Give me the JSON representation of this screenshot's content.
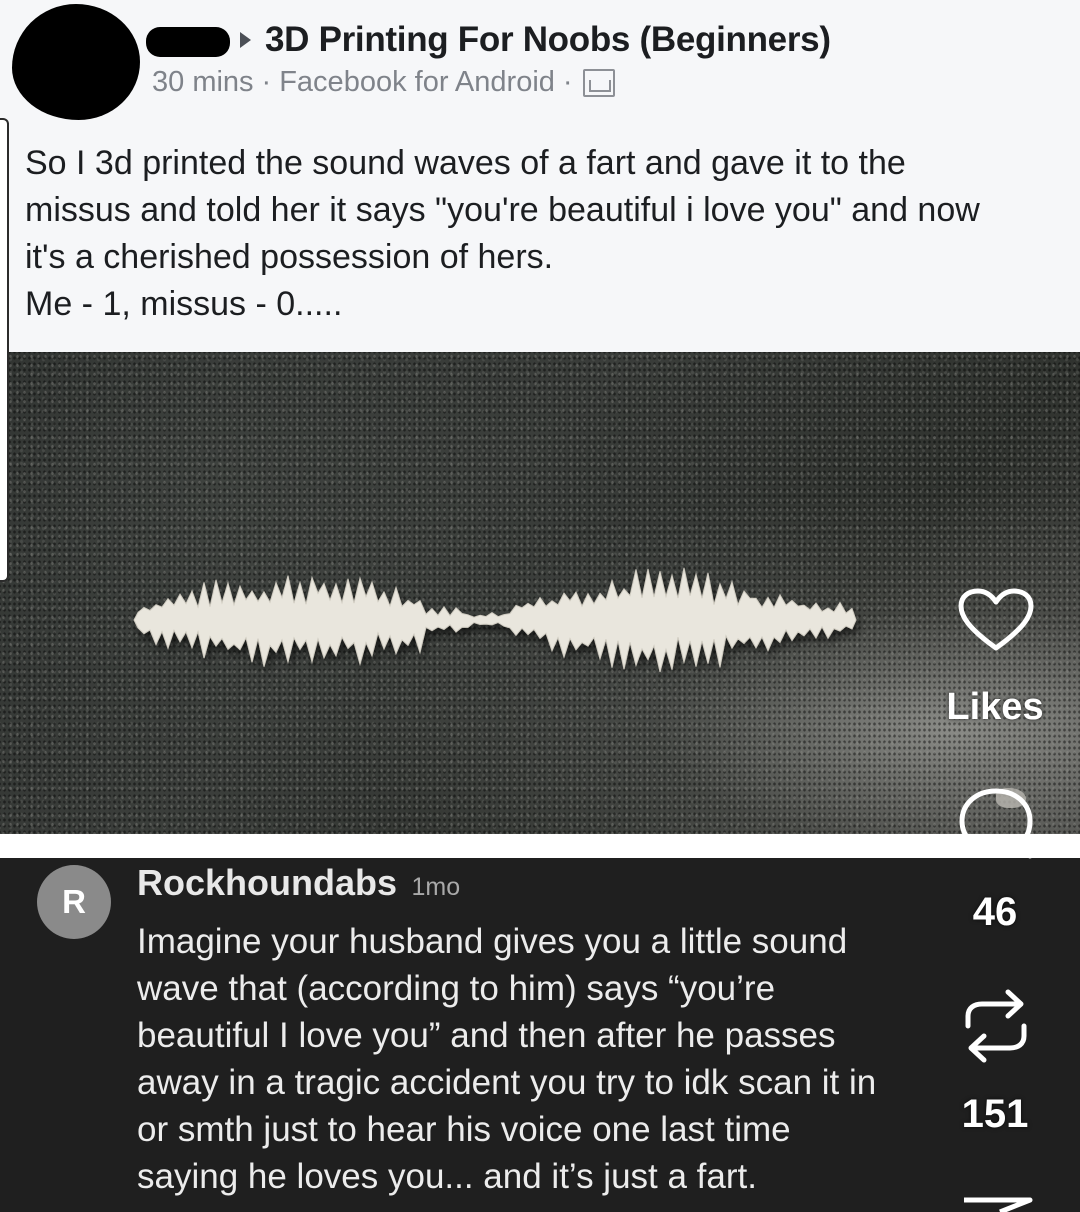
{
  "post": {
    "group_name": "3D Printing For Noobs (Beginners)",
    "time": "30 mins",
    "source": "Facebook for Android",
    "separator": "·",
    "text": "So I 3d printed the sound waves of a fart and gave it to the\nmissus and told her it says \"you're beautiful i love you\" and now\nit's a cherished possession of hers.\nMe - 1, missus - 0....."
  },
  "comment": {
    "avatar_letter": "R",
    "username": "Rockhoundabs",
    "time": "1mo",
    "text": "Imagine your husband gives you a little sound\nwave that (according to him) says “you’re\nbeautiful I love you” and then after he passes\naway in a tragic accident you try to idk scan it in\nor smth just to hear his voice one last time\nsaying he loves you... and it’s just a fart."
  },
  "overlay": {
    "likes_label": "Likes",
    "comments_count": "46",
    "reposts_count": "151",
    "icons": [
      "heart-icon",
      "comment-icon",
      "repost-icon",
      "share-icon"
    ]
  },
  "colors": {
    "post_background": "#f6f7f9",
    "comment_background": "#1f1f1f",
    "overlay_text": "#ffffff",
    "avatar_gray": "#8a8a8a"
  }
}
